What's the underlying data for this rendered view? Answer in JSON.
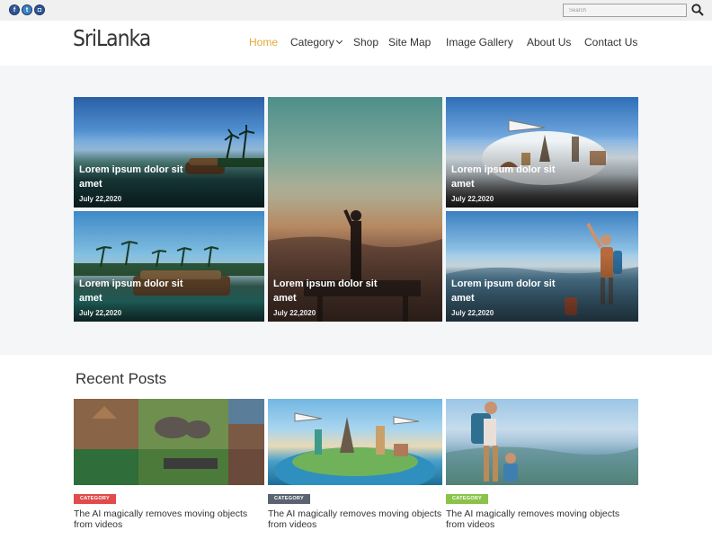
{
  "topbar": {
    "social": [
      {
        "name": "facebook",
        "glyph": "f"
      },
      {
        "name": "twitter",
        "glyph": "t"
      },
      {
        "name": "instagram",
        "glyph": "◘"
      }
    ],
    "search_placeholder": "Search"
  },
  "header": {
    "logo": "SriLanka",
    "nav": [
      {
        "label": "Home",
        "active": true
      },
      {
        "label": "Category",
        "dropdown": true
      },
      {
        "label": "Shop"
      },
      {
        "label": "Site Map"
      },
      {
        "label": "Image Gallery"
      },
      {
        "label": "About Us"
      },
      {
        "label": "Contact Us"
      }
    ]
  },
  "hero": {
    "cards": [
      {
        "title": "Lorem ipsum dolor sit amet",
        "date": "July 22,2020"
      },
      {
        "title": "Lorem ipsum dolor sit amet",
        "date": "July 22,2020"
      },
      {
        "title": "Lorem ipsum dolor sit amet",
        "date": "July 22,2020"
      },
      {
        "title": "Lorem ipsum dolor sit amet",
        "date": "July 22,2020"
      },
      {
        "title": "Lorem ipsum dolor sit amet",
        "date": "July 22,2020"
      }
    ]
  },
  "recent": {
    "heading": "Recent Posts",
    "posts": [
      {
        "category": "CATEGORY",
        "category_color": "#e14b4b",
        "title": "The AI magically removes moving objects from videos"
      },
      {
        "category": "CATEGORY",
        "category_color": "#5c6370",
        "title": "The AI magically removes moving objects from videos"
      },
      {
        "category": "CATEGORY",
        "category_color": "#8bc34a",
        "title": "The AI magically removes moving objects from videos"
      }
    ]
  },
  "colors": {
    "accent": "#e2a93b",
    "text": "#333333",
    "hero_bg": "#f4f6f8",
    "topbar_bg": "#f0f0f0"
  }
}
